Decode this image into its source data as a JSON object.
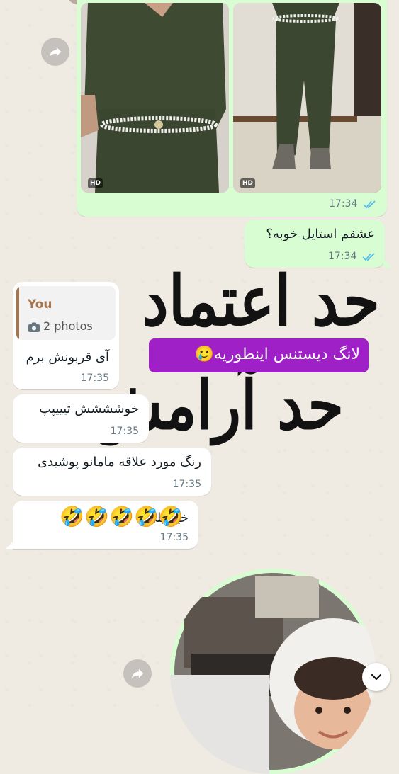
{
  "messages": {
    "photo_album": {
      "time": "17:34",
      "badge_left": "HD",
      "badge_right": "HD"
    },
    "question": {
      "text": "عشقم استایل خوبه؟",
      "time": "17:34"
    },
    "quote": {
      "author": "You",
      "media": "2 photos"
    },
    "reply1": {
      "text": "آی قربونش برم",
      "time": "17:35"
    },
    "reply2": {
      "text": "خوشششش تیییپپ",
      "time": "17:35"
    },
    "reply3": {
      "text": "رنگ مورد علاقه مامانو پوشیدی",
      "time": "17:35"
    },
    "reply4": {
      "text": "خیییییلی",
      "emoji": "🤣🤣🤣🤣🤣",
      "time": "17:35"
    }
  },
  "sticker": {
    "line1": "حد اعتماد",
    "line2": "حد آرامش",
    "caption": "لانگ دیستنس اینطوریه🥲"
  },
  "colors": {
    "outgoing_bubble": "#d9fdd3",
    "incoming_bubble": "#ffffff",
    "read_ticks": "#53bdeb",
    "caption_bg": "#a020c8",
    "quote_bar": "#a5754d"
  },
  "icons": {
    "forward": "forward-arrow-icon",
    "scroll_down": "chevron-down-icon",
    "camera": "camera-icon"
  }
}
